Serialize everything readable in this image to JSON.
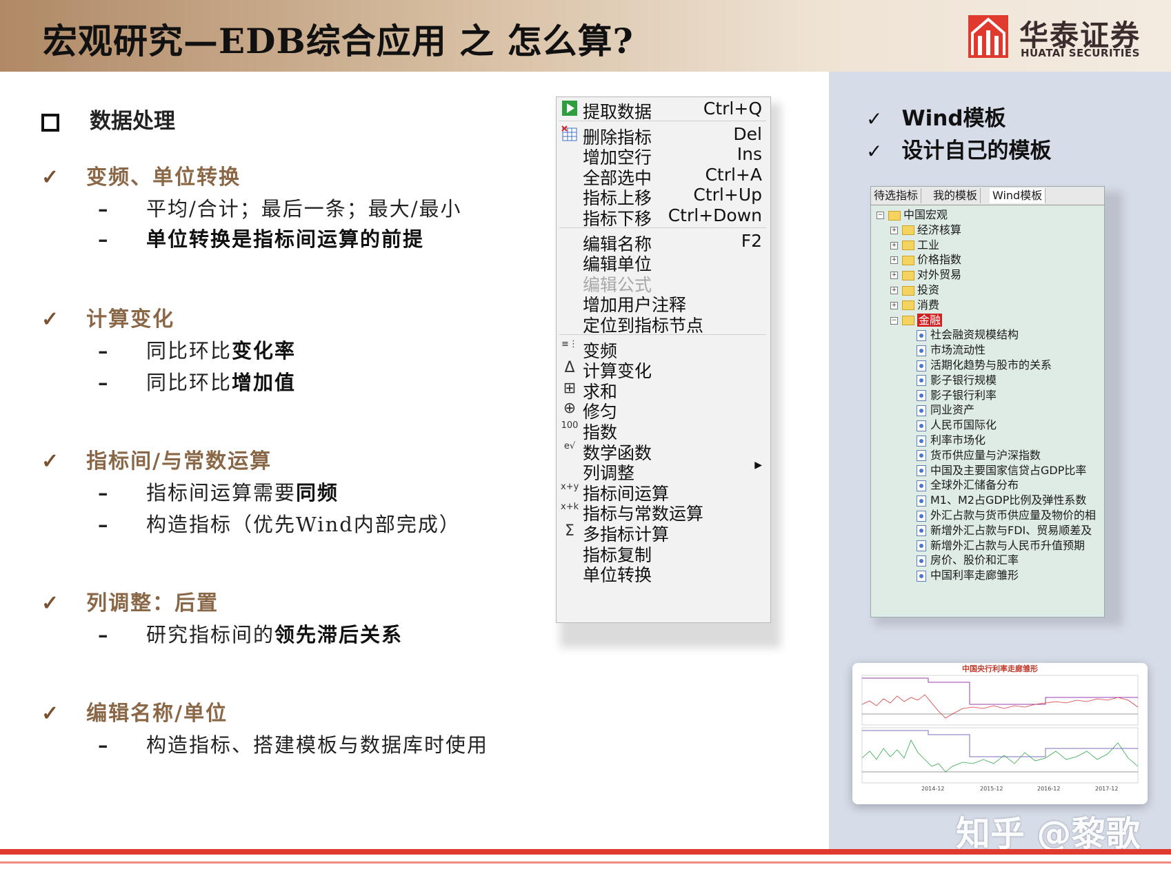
{
  "header": {
    "title": "宏观研究—EDB综合应用 之 怎么算?",
    "logo_cn": "华泰证券",
    "logo_en": "HUATAI SECURITIES"
  },
  "outline": {
    "section": "数据处理",
    "items": [
      {
        "heading": "变频、单位转换",
        "subs": [
          {
            "plain": "平均/合计；最后一条；最大/最小",
            "bold": ""
          },
          {
            "plain": "",
            "bold": "单位转换是指标间运算的前提"
          }
        ]
      },
      {
        "heading": "计算变化",
        "subs": [
          {
            "plain": "同比环比",
            "bold": "变化率"
          },
          {
            "plain": "同比环比",
            "bold": "增加值"
          }
        ]
      },
      {
        "heading": "指标间/与常数运算",
        "subs": [
          {
            "plain": "指标间运算需要",
            "bold": "同频"
          },
          {
            "plain": "构造指标（优先Wind内部完成）",
            "bold": ""
          }
        ]
      },
      {
        "heading": "列调整：后置",
        "subs": [
          {
            "plain": "研究指标间的",
            "bold": "领先滞后关系"
          }
        ]
      },
      {
        "heading": "编辑名称/单位",
        "subs": [
          {
            "plain": "构造指标、搭建模板与数据库时使用",
            "bold": ""
          }
        ]
      }
    ]
  },
  "menu": {
    "items": [
      {
        "label": "提取数据",
        "shortcut": "Ctrl+Q",
        "icon": "play-icon"
      },
      {
        "label": "删除指标",
        "shortcut": "Del",
        "icon": "delete-table-icon"
      },
      {
        "label": "增加空行",
        "shortcut": "Ins",
        "icon": ""
      },
      {
        "label": "全部选中",
        "shortcut": "Ctrl+A",
        "icon": ""
      },
      {
        "label": "指标上移",
        "shortcut": "Ctrl+Up",
        "icon": ""
      },
      {
        "label": "指标下移",
        "shortcut": "Ctrl+Down",
        "icon": ""
      },
      {
        "label": "编辑名称",
        "shortcut": "F2",
        "icon": ""
      },
      {
        "label": "编辑单位",
        "shortcut": "",
        "icon": ""
      },
      {
        "label": "编辑公式",
        "shortcut": "",
        "icon": "",
        "disabled": true
      },
      {
        "label": "增加用户注释",
        "shortcut": "",
        "icon": ""
      },
      {
        "label": "定位到指标节点",
        "shortcut": "",
        "icon": ""
      },
      {
        "label": "变频",
        "shortcut": "",
        "icon": "frequency-icon",
        "glyph": "≡⋮"
      },
      {
        "label": "计算变化",
        "shortcut": "",
        "icon": "delta-icon",
        "glyph": "Δ"
      },
      {
        "label": "求和",
        "shortcut": "",
        "icon": "sum-bars-icon",
        "glyph": "⊞"
      },
      {
        "label": "修匀",
        "shortcut": "",
        "icon": "smooth-icon",
        "glyph": "⊕"
      },
      {
        "label": "指数",
        "shortcut": "",
        "icon": "index-icon",
        "glyph": "100"
      },
      {
        "label": "数学函数",
        "shortcut": "",
        "icon": "math-function-icon",
        "glyph": "e√"
      },
      {
        "label": "列调整",
        "shortcut": "▶",
        "icon": ""
      },
      {
        "label": "指标间运算",
        "shortcut": "",
        "icon": "series-op-icon",
        "glyph": "x+y"
      },
      {
        "label": "指标与常数运算",
        "shortcut": "",
        "icon": "const-op-icon",
        "glyph": "x+k"
      },
      {
        "label": "多指标计算",
        "shortcut": "",
        "icon": "sigma-icon",
        "glyph": "Σ"
      },
      {
        "label": "指标复制",
        "shortcut": "",
        "icon": ""
      },
      {
        "label": "单位转换",
        "shortcut": "",
        "icon": ""
      }
    ]
  },
  "wind": {
    "checks": [
      "Wind模板",
      "设计自己的模板"
    ],
    "tabs": [
      "待选指标",
      "我的模板",
      "Wind模板"
    ],
    "root": "中国宏观",
    "folders": [
      "经济核算",
      "工业",
      "价格指数",
      "对外贸易",
      "投资",
      "消费"
    ],
    "open_folder": "金融",
    "leaves": [
      "社会融资规模结构",
      "市场流动性",
      "活期化趋势与股市的关系",
      "影子银行规模",
      "影子银行利率",
      "同业资产",
      "人民币国际化",
      "利率市场化",
      "货币供应量与沪深指数",
      "中国及主要国家信贷占GDP比率",
      "全球外汇储备分布",
      "M1、M2占GDP比例及弹性系数",
      "外汇占款与货币供应量及物价的相",
      "新增外汇占款与FDI、贸易顺差及",
      "新增外汇占款与人民币升值预期",
      "房价、股价和汇率",
      "中国利率走廊雏形"
    ]
  },
  "chart": {
    "title": "中国央行利率走廊雏形",
    "x_ticks": [
      "2014-12",
      "2015-12",
      "2016-12",
      "2017-12"
    ]
  },
  "watermark": "知乎 @黎歌"
}
